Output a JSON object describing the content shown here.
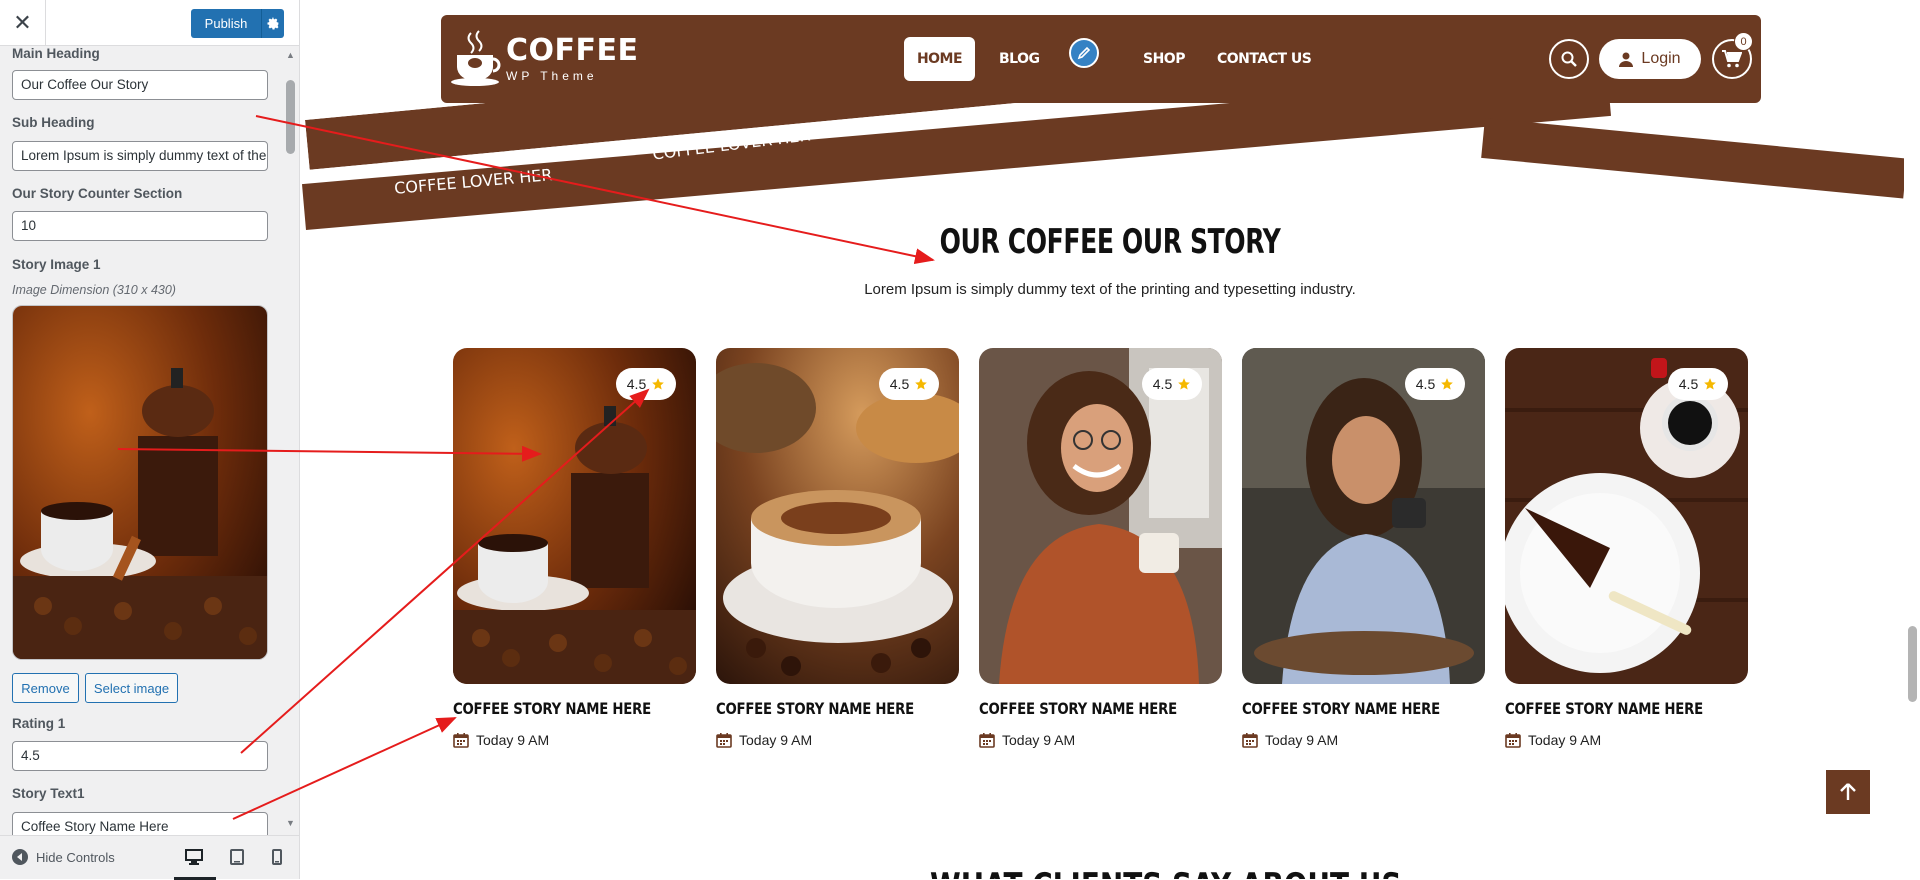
{
  "customizer": {
    "close_label": "✕",
    "publish_label": "Publish",
    "fields": {
      "main_heading_label": "Main Heading",
      "main_heading_value": "Our Coffee Our Story",
      "sub_heading_label": "Sub Heading",
      "sub_heading_value": "Lorem Ipsum is simply dummy text of the printing and typesetting industry.",
      "counter_label": "Our Story Counter Section",
      "counter_value": "10",
      "image1_label": "Story Image 1",
      "image1_desc": "Image Dimension (310 x 430)",
      "remove_label": "Remove",
      "select_image_label": "Select image",
      "rating1_label": "Rating 1",
      "rating1_value": "4.5",
      "story_text1_label": "Story Text1",
      "story_text1_value": "Coffee Story Name Here"
    },
    "footer": {
      "hide_controls_label": "Hide Controls"
    }
  },
  "site": {
    "logo_title": "COFFEE",
    "logo_sub": "WP Theme",
    "nav": [
      "HOME",
      "BLOG",
      "SHOP",
      "CONTACT US"
    ],
    "login_label": "Login",
    "cart_count": "0",
    "ribbon_texts": [
      "COFFEE LOVER HER",
      "COFFEE LOVER HER",
      "COF"
    ],
    "section_title": "OUR COFFEE OUR STORY",
    "section_sub": "Lorem Ipsum is simply dummy text of the printing and typesetting industry.",
    "cards": [
      {
        "rating": "4.5",
        "name": "COFFEE STORY NAME HERE",
        "date": "Today 9 AM",
        "image": "coffee-grinder-photo"
      },
      {
        "rating": "4.5",
        "name": "COFFEE STORY NAME HERE",
        "date": "Today 9 AM",
        "image": "cappuccino-photo"
      },
      {
        "rating": "4.5",
        "name": "COFFEE STORY NAME HERE",
        "date": "Today 9 AM",
        "image": "woman-laughing-photo"
      },
      {
        "rating": "4.5",
        "name": "COFFEE STORY NAME HERE",
        "date": "Today 9 AM",
        "image": "woman-sipping-photo"
      },
      {
        "rating": "4.5",
        "name": "COFFEE STORY NAME HERE",
        "date": "Today 9 AM",
        "image": "espresso-cake-photo"
      }
    ],
    "next_section_title": "WHAT CLIENTS SAY ABOUT US"
  },
  "colors": {
    "brand_brown": "#6b3a22",
    "wp_blue": "#2271b1",
    "annotation_red": "#e51c1c",
    "star_yellow": "#f5b800"
  }
}
